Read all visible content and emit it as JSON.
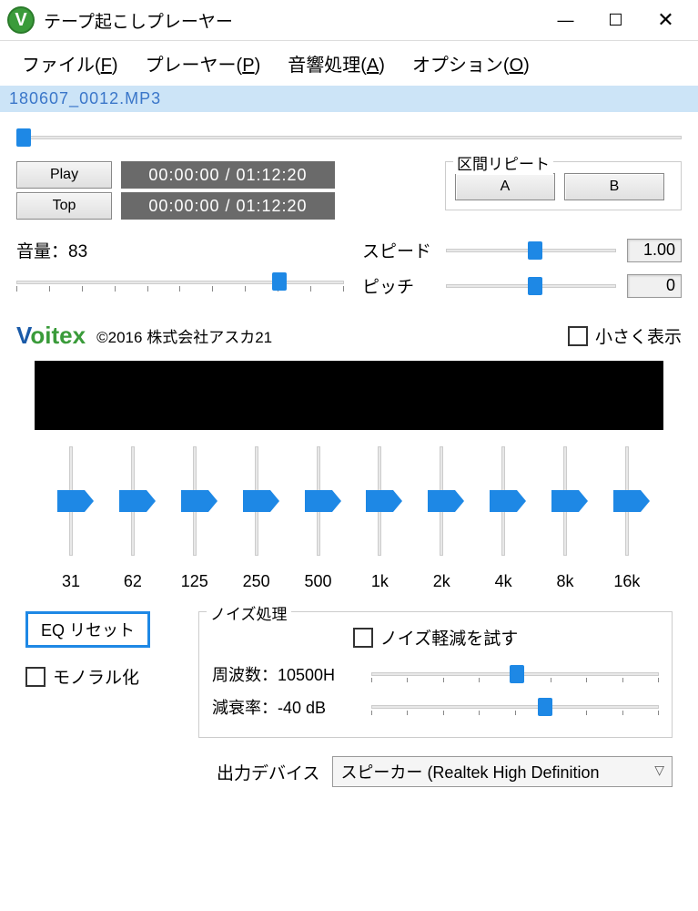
{
  "window": {
    "title": "テープ起こしプレーヤー"
  },
  "menu": {
    "file": "ファイル(F)",
    "player": "プレーヤー(P)",
    "audio": "音響処理(A)",
    "options": "オプション(O)"
  },
  "filename": "180607_0012.MP3",
  "playback": {
    "play_label": "Play",
    "top_label": "Top",
    "time1": "00:00:00 / 01:12:20",
    "time2": "00:00:00 / 01:12:20"
  },
  "repeat": {
    "legend": "区間リピート",
    "a_label": "A",
    "b_label": "B"
  },
  "volume": {
    "label": "音量：83",
    "value": 83
  },
  "speed": {
    "label": "スピード",
    "value": "1.00"
  },
  "pitch": {
    "label": "ピッチ",
    "value": "0"
  },
  "brand": {
    "copyright": "©2016 株式会社アスカ21"
  },
  "compact": {
    "label": "小さく表示",
    "checked": false
  },
  "eq": {
    "bands": [
      "31",
      "62",
      "125",
      "250",
      "500",
      "1k",
      "2k",
      "4k",
      "8k",
      "16k"
    ],
    "reset_label": "EQ リセット"
  },
  "mono": {
    "label": "モノラル化",
    "checked": false
  },
  "noise": {
    "legend": "ノイズ処理",
    "try_label": "ノイズ軽減を試す",
    "try_checked": false,
    "freq_label": "周波数：10500H",
    "freq_value": 10500,
    "atten_label": "減衰率：-40 dB",
    "atten_value": -40
  },
  "output": {
    "label": "出力デバイス",
    "selected": "スピーカー (Realtek High Definition"
  }
}
